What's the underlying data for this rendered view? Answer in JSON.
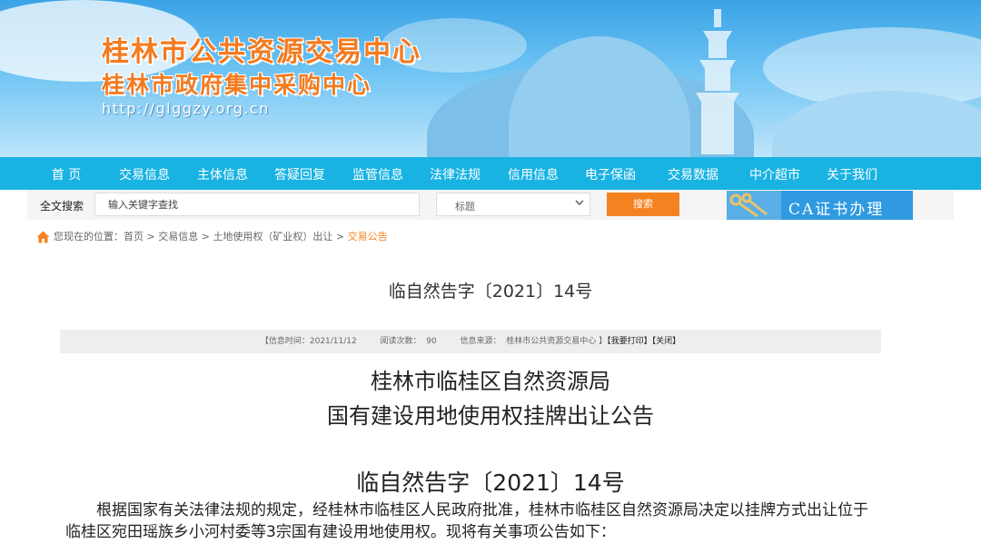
{
  "header": {
    "title1": "桂林市公共资源交易中心",
    "title2": "桂林市政府集中采购中心",
    "url": "http://glggzy.org.cn"
  },
  "nav": {
    "items": [
      "首 页",
      "交易信息",
      "主体信息",
      "答疑回复",
      "监管信息",
      "法律法规",
      "信用信息",
      "电子保函",
      "交易数据",
      "中介超市",
      "关于我们"
    ]
  },
  "search": {
    "label": "全文搜索",
    "placeholder": "输入关键字查找",
    "select_value": "标题",
    "button": "搜索"
  },
  "ca_banner": {
    "label": "CA证书办理"
  },
  "breadcrumb": {
    "prefix": "您现在的位置：",
    "items": [
      "首页",
      "交易信息",
      "土地使用权（矿业权）出让"
    ],
    "sep": " > ",
    "current": "交易公告"
  },
  "article": {
    "doc_title": "临自然告字〔2021〕14号",
    "info": {
      "time_label": "【信息时间：",
      "time": "2021/11/12",
      "views_label": "阅读次数：",
      "views": "90",
      "source_label": "信息来源：",
      "source": "桂林市公共资源交易中心",
      "close_bracket": "】",
      "print": "【我要打印】",
      "close": "【关闭】"
    },
    "heading1": "桂林市临桂区自然资源局",
    "heading2": "国有建设用地使用权挂牌出让公告",
    "number": "临自然告字〔2021〕14号",
    "body": "根据国家有关法律法规的规定，经桂林市临桂区人民政府批准，桂林市临桂区自然资源局决定以挂牌方式出让位于临桂区宛田瑶族乡小河村委等3宗国有建设用地使用权。现将有关事项公告如下："
  },
  "colors": {
    "nav_bg": "#19b3e3",
    "accent_orange": "#f58220",
    "title_orange": "#f47a1f",
    "ca_blue": "#2f9ae0"
  }
}
